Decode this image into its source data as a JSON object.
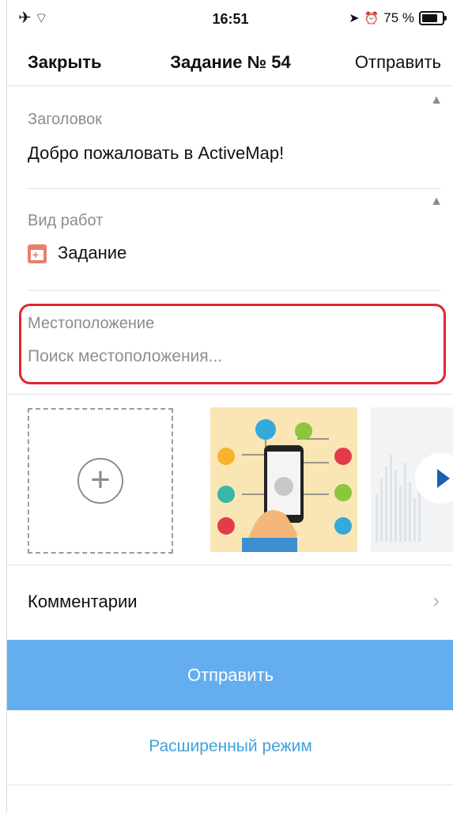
{
  "status_bar": {
    "time": "16:51",
    "battery_percent": "75 %"
  },
  "nav": {
    "close_label": "Закрыть",
    "title": "Задание № 54",
    "send_label": "Отправить"
  },
  "fields": {
    "heading": {
      "label": "Заголовок",
      "value": "Добро пожаловать в ActiveMap!"
    },
    "work_type": {
      "label": "Вид работ",
      "value": "Задание"
    },
    "location": {
      "label": "Местоположение",
      "placeholder": "Поиск местоположения..."
    }
  },
  "comments": {
    "label": "Комментарии"
  },
  "actions": {
    "submit_label": "Отправить",
    "advanced_label": "Расширенный режим"
  },
  "colors": {
    "accent": "#64aef0",
    "highlight": "#e0252f",
    "link": "#42a1d7"
  }
}
